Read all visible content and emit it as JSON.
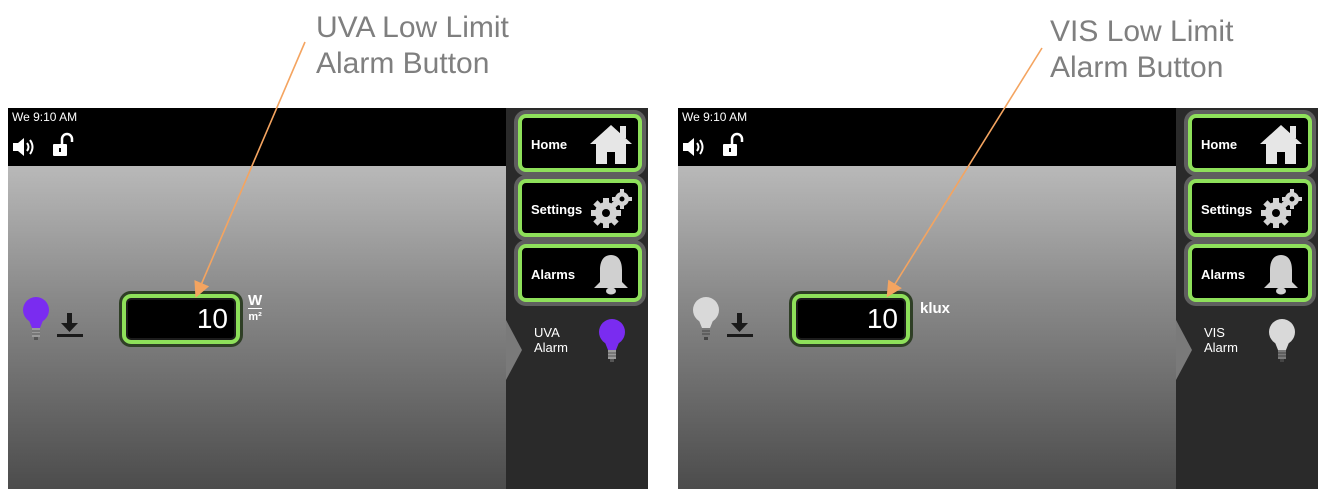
{
  "annotations": {
    "left": {
      "line1": "UVA Low Limit",
      "line2": "Alarm Button"
    },
    "right": {
      "line1": "VIS Low Limit",
      "line2": "Alarm Button"
    }
  },
  "colors": {
    "accent_green": "#8ee05a",
    "uva_purple": "#7a2cf0",
    "vis_gray": "#d9d9d9",
    "callout_arrow": "#f4a460"
  },
  "screens": [
    {
      "status": {
        "time": "We 9:10 AM",
        "sound_icon": "speaker-icon",
        "lock_icon": "unlock-icon"
      },
      "row": {
        "bulb_icon": "bulb-icon",
        "low_limit_icon": "arrow-down-to-line-icon",
        "value": "10",
        "unit_numerator": "W",
        "unit_denominator": "m²"
      },
      "nav": {
        "home": "Home",
        "settings": "Settings",
        "alarms": "Alarms"
      },
      "side_alarm": {
        "line1": "UVA",
        "line2": "Alarm"
      }
    },
    {
      "status": {
        "time": "We 9:10 AM",
        "sound_icon": "speaker-icon",
        "lock_icon": "unlock-icon"
      },
      "row": {
        "bulb_icon": "bulb-icon",
        "low_limit_icon": "arrow-down-to-line-icon",
        "value": "10",
        "unit": "klux"
      },
      "nav": {
        "home": "Home",
        "settings": "Settings",
        "alarms": "Alarms"
      },
      "side_alarm": {
        "line1": "VIS",
        "line2": "Alarm"
      }
    }
  ]
}
